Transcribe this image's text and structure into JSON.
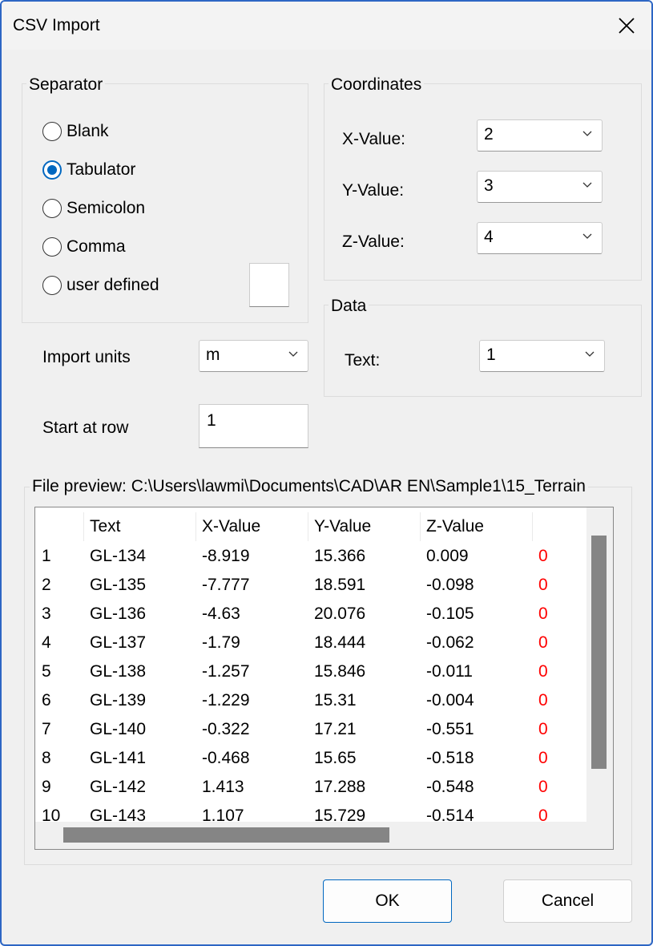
{
  "window": {
    "title": "CSV Import"
  },
  "separator": {
    "label": "Separator",
    "options": [
      {
        "label": "Blank",
        "checked": false
      },
      {
        "label": "Tabulator",
        "checked": true
      },
      {
        "label": "Semicolon",
        "checked": false
      },
      {
        "label": "Comma",
        "checked": false
      },
      {
        "label": "user defined",
        "checked": false
      }
    ],
    "user_defined_value": ""
  },
  "coordinates": {
    "label": "Coordinates",
    "x_label": "X-Value:",
    "x_value": "2",
    "y_label": "Y-Value:",
    "y_value": "3",
    "z_label": "Z-Value:",
    "z_value": "4"
  },
  "data": {
    "label": "Data",
    "text_label": "Text:",
    "text_value": "1"
  },
  "import_units": {
    "label": "Import units",
    "value": "m"
  },
  "start_row": {
    "label": "Start at row",
    "value": "1"
  },
  "preview": {
    "label": "File preview: C:\\Users\\lawmi\\Documents\\CAD\\AR EN\\Sample1\\15_Terrain",
    "columns": [
      "",
      "Text",
      "X-Value",
      "Y-Value",
      "Z-Value",
      ""
    ],
    "rows": [
      [
        "1",
        "GL-134",
        "-8.919",
        "15.366",
        "0.009",
        "0"
      ],
      [
        "2",
        "GL-135",
        "-7.777",
        "18.591",
        "-0.098",
        "0"
      ],
      [
        "3",
        "GL-136",
        "-4.63",
        "20.076",
        "-0.105",
        "0"
      ],
      [
        "4",
        "GL-137",
        "-1.79",
        "18.444",
        "-0.062",
        "0"
      ],
      [
        "5",
        "GL-138",
        "-1.257",
        "15.846",
        "-0.011",
        "0"
      ],
      [
        "6",
        "GL-139",
        "-1.229",
        "15.31",
        "-0.004",
        "0"
      ],
      [
        "7",
        "GL-140",
        "-0.322",
        "17.21",
        "-0.551",
        "0"
      ],
      [
        "8",
        "GL-141",
        "-0.468",
        "15.65",
        "-0.518",
        "0"
      ],
      [
        "9",
        "GL-142",
        "1.413",
        "17.288",
        "-0.548",
        "0"
      ],
      [
        "10",
        "GL-143",
        "1.107",
        "15.729",
        "-0.514",
        "0"
      ]
    ],
    "flag_color": "#ff0000"
  },
  "buttons": {
    "ok": "OK",
    "cancel": "Cancel"
  },
  "colors": {
    "accent": "#0067c0",
    "border": "#2d66c4"
  }
}
